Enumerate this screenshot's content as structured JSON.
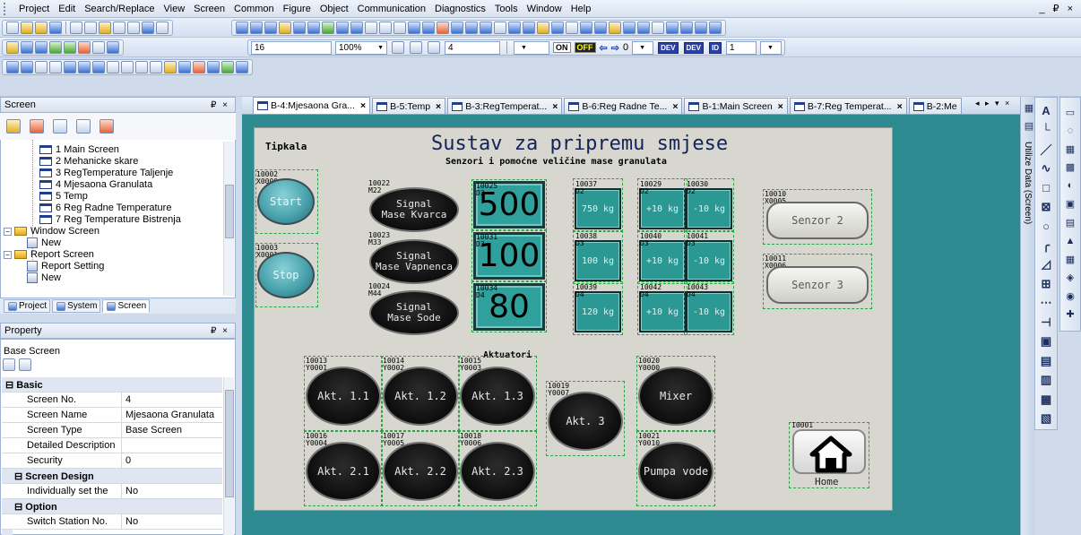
{
  "menubar": {
    "items": [
      "Project",
      "Edit",
      "Search/Replace",
      "View",
      "Screen",
      "Common",
      "Figure",
      "Object",
      "Communication",
      "Diagnostics",
      "Tools",
      "Window",
      "Help"
    ],
    "window_controls": "_ ₽ ×"
  },
  "toolbar": {
    "font_size": "16",
    "zoom": "100%",
    "grid": "4",
    "on_label": "ON",
    "off_label": "OFF",
    "step": "0",
    "dev_labels": [
      "DEV",
      "DEV",
      "ID"
    ],
    "station": "1"
  },
  "screen_panel": {
    "title": "Screen",
    "pin": "₽ ×",
    "tree": [
      {
        "label": "1 Main Screen",
        "kind": "page"
      },
      {
        "label": "2 Mehanicke skare",
        "kind": "page"
      },
      {
        "label": "3 RegTemperature Taljenje",
        "kind": "page"
      },
      {
        "label": "4 Mjesaona Granulata",
        "kind": "page"
      },
      {
        "label": "5 Temp",
        "kind": "page"
      },
      {
        "label": "6 Reg Radne Temperature",
        "kind": "page"
      },
      {
        "label": "7 Reg Temperature Bistrenja",
        "kind": "page"
      },
      {
        "label": "Window Screen",
        "kind": "folder"
      },
      {
        "label": "New",
        "kind": "new"
      },
      {
        "label": "Report Screen",
        "kind": "folder"
      },
      {
        "label": "Report Setting",
        "kind": "new"
      },
      {
        "label": "New",
        "kind": "new"
      }
    ],
    "tabs": [
      "Project",
      "System",
      "Screen"
    ]
  },
  "property_panel": {
    "title": "Property",
    "pin": "₽ ×",
    "object_title": "Base Screen",
    "rows": [
      {
        "key": "Basic",
        "value": "",
        "type": "cat"
      },
      {
        "key": "Screen No.",
        "value": "4",
        "type": "row"
      },
      {
        "key": "Screen Name",
        "value": "Mjesaona Granulata",
        "type": "row"
      },
      {
        "key": "Screen Type",
        "value": "Base Screen",
        "type": "row"
      },
      {
        "key": "Detailed Description",
        "value": "",
        "type": "row"
      },
      {
        "key": "Security",
        "value": "0",
        "type": "row"
      },
      {
        "key": "Screen Design",
        "value": "",
        "type": "sub"
      },
      {
        "key": "Individually set the",
        "value": "No",
        "type": "row"
      },
      {
        "key": "Option",
        "value": "",
        "type": "sub"
      },
      {
        "key": "Switch Station No.",
        "value": "No",
        "type": "row"
      }
    ]
  },
  "doc_tabs": [
    {
      "label": "B-4:Mjesaona Gra...",
      "active": true
    },
    {
      "label": "B-5:Temp",
      "active": false
    },
    {
      "label": "B-3:RegTemperat...",
      "active": false
    },
    {
      "label": "B-6:Reg Radne Te...",
      "active": false
    },
    {
      "label": "B-1:Main Screen",
      "active": false
    },
    {
      "label": "B-7:Reg Temperat...",
      "active": false
    },
    {
      "label": "B-2:Me",
      "active": false
    }
  ],
  "right_strip_label": "Utilize Data (Screen)",
  "canvas": {
    "heading": "Sustav za pripremu smjese",
    "subheading": "Senzori i pomoćne veličine mase granulata",
    "tipkala_label": "Tipkala",
    "aktuatori_label": "Aktuatori",
    "buttons": [
      {
        "id": "start",
        "tag": "10002\nX0000",
        "label": "Start"
      },
      {
        "id": "stop",
        "tag": "10003\nX0001",
        "label": "Stop"
      }
    ],
    "signal_lamps": [
      {
        "id": "kvarc",
        "tag": "10022\nM22",
        "label": "Signal\nMase Kvarca"
      },
      {
        "id": "vapnenac",
        "tag": "10023\nM33",
        "label": "Signal\nMase Vapnenca"
      },
      {
        "id": "soda",
        "tag": "10024\nM44",
        "label": "Signal\nMase Sode"
      }
    ],
    "numeric_displays": [
      {
        "id": "d2",
        "tag": "10025\nD2",
        "value": "500"
      },
      {
        "id": "d3",
        "tag": "10031\nD3",
        "value": "100"
      },
      {
        "id": "d4",
        "tag": "10034\nD4",
        "value": "80"
      }
    ],
    "mass_boxes": [
      {
        "tag": "10037\nD2",
        "label": "750 kg"
      },
      {
        "tag": "10029\nD2",
        "label": "+10 kg"
      },
      {
        "tag": "10030\nD2",
        "label": "-10 kg"
      },
      {
        "tag": "10038\nD3",
        "label": "100 kg"
      },
      {
        "tag": "10040\nD3",
        "label": "+10 kg"
      },
      {
        "tag": "10041\nD3",
        "label": "-10 kg"
      },
      {
        "tag": "10039\nD4",
        "label": "120 kg"
      },
      {
        "tag": "10042\nD4",
        "label": "+10 kg"
      },
      {
        "tag": "10043\nD4",
        "label": "-10 kg"
      }
    ],
    "sensors": [
      {
        "tag": "10010\nX0005",
        "label": "Senzor 2"
      },
      {
        "tag": "10011\nX0006",
        "label": "Senzor 3"
      }
    ],
    "actuators": [
      {
        "tag": "10013\nY0001",
        "label": "Akt. 1.1"
      },
      {
        "tag": "10014\nY0002",
        "label": "Akt. 1.2"
      },
      {
        "tag": "10015\nY0003",
        "label": "Akt. 1.3"
      },
      {
        "tag": "10019\nY0007",
        "label": "Akt. 3"
      },
      {
        "tag": "10020\nY0000",
        "label": "Mixer"
      },
      {
        "tag": "10016\nY0004",
        "label": "Akt. 2.1"
      },
      {
        "tag": "10017\nY0005",
        "label": "Akt. 2.2"
      },
      {
        "tag": "10018\nY0006",
        "label": "Akt. 2.3"
      },
      {
        "tag": "10021\nY0010",
        "label": "Pumpa vode"
      }
    ],
    "home": {
      "tag": "10001",
      "label": "Home"
    }
  },
  "right_tools_1": [
    "A",
    "└",
    "／",
    "∿",
    "□",
    "⊠",
    "○",
    "╭",
    "◿",
    "⊞",
    "⋯",
    "⊣",
    "▣",
    "▤",
    "▥",
    "▦",
    "▧"
  ],
  "right_tools_2": [
    "▭",
    "◌",
    "▦",
    "▩",
    "◐",
    "▣",
    "▤",
    "▲",
    "▦",
    "◈",
    "◉",
    "✚"
  ]
}
